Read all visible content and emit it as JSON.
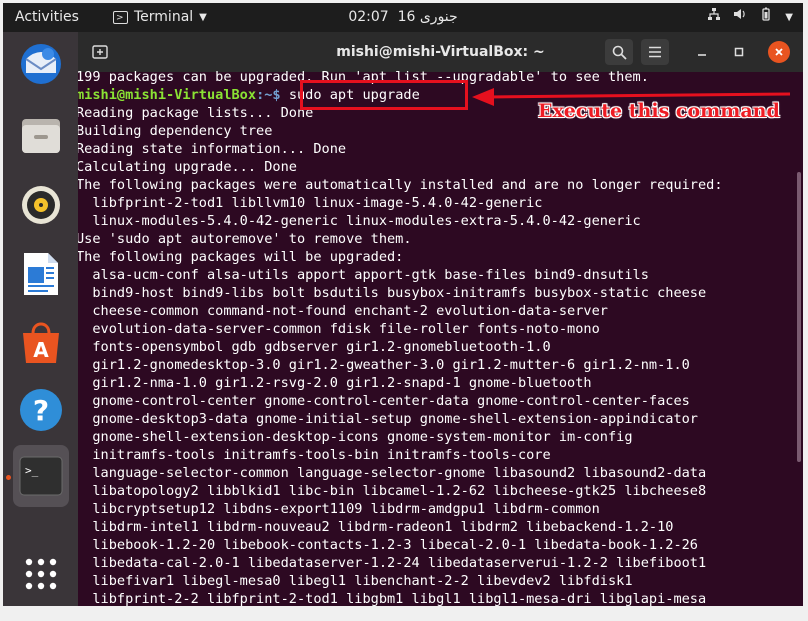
{
  "topbar": {
    "activities": "Activities",
    "app_menu": "Terminal",
    "clock_time": "02:07",
    "clock_date": "16 جنوری",
    "icons": [
      "network-icon",
      "volume-icon",
      "battery-icon",
      "power-menu-icon"
    ]
  },
  "dock": {
    "items": [
      "thunderbird",
      "files",
      "rhythmbox",
      "libreoffice-writer",
      "ubuntu-software",
      "help",
      "terminal",
      "show-applications"
    ],
    "active": "terminal"
  },
  "window": {
    "title": "mishi@mishi-VirtualBox: ~"
  },
  "terminal": {
    "prompt_user": "mishi@mishi-VirtualBox",
    "prompt_sep": ":~$ ",
    "command": "sudo apt upgrade",
    "lines": [
      "199 packages can be upgraded. Run 'apt list --upgradable' to see them.",
      "Reading package lists... Done",
      "Building dependency tree",
      "Reading state information... Done",
      "Calculating upgrade... Done",
      "The following packages were automatically installed and are no longer required:",
      "  libfprint-2-tod1 libllvm10 linux-image-5.4.0-42-generic",
      "  linux-modules-5.4.0-42-generic linux-modules-extra-5.4.0-42-generic",
      "Use 'sudo apt autoremove' to remove them.",
      "The following packages will be upgraded:",
      "  alsa-ucm-conf alsa-utils apport apport-gtk base-files bind9-dnsutils",
      "  bind9-host bind9-libs bolt bsdutils busybox-initramfs busybox-static cheese",
      "  cheese-common command-not-found enchant-2 evolution-data-server",
      "  evolution-data-server-common fdisk file-roller fonts-noto-mono",
      "  fonts-opensymbol gdb gdbserver gir1.2-gnomebluetooth-1.0",
      "  gir1.2-gnomedesktop-3.0 gir1.2-gweather-3.0 gir1.2-mutter-6 gir1.2-nm-1.0",
      "  gir1.2-nma-1.0 gir1.2-rsvg-2.0 gir1.2-snapd-1 gnome-bluetooth",
      "  gnome-control-center gnome-control-center-data gnome-control-center-faces",
      "  gnome-desktop3-data gnome-initial-setup gnome-shell-extension-appindicator",
      "  gnome-shell-extension-desktop-icons gnome-system-monitor im-config",
      "  initramfs-tools initramfs-tools-bin initramfs-tools-core",
      "  language-selector-common language-selector-gnome libasound2 libasound2-data",
      "  libatopology2 libblkid1 libc-bin libcamel-1.2-62 libcheese-gtk25 libcheese8",
      "  libcryptsetup12 libdns-export1109 libdrm-amdgpu1 libdrm-common",
      "  libdrm-intel1 libdrm-nouveau2 libdrm-radeon1 libdrm2 libebackend-1.2-10",
      "  libebook-1.2-20 libebook-contacts-1.2-3 libecal-2.0-1 libedata-book-1.2-26",
      "  libedata-cal-2.0-1 libedataserver-1.2-24 libedataserverui-1.2-2 libefiboot1",
      "  libefivar1 libegl-mesa0 libegl1 libenchant-2-2 libevdev2 libfdisk1",
      "  libfprint-2-2 libfprint-2-tod1 libgbm1 libgl1 libgl1-mesa-dri libglapi-mesa"
    ]
  },
  "annotation": {
    "text": "Execute this command",
    "color": "#ee1c24"
  },
  "colors": {
    "terminal_bg": "#2d0922",
    "prompt_user": "#8ae234",
    "prompt_path": "#729fcf",
    "accent": "#e95420"
  }
}
